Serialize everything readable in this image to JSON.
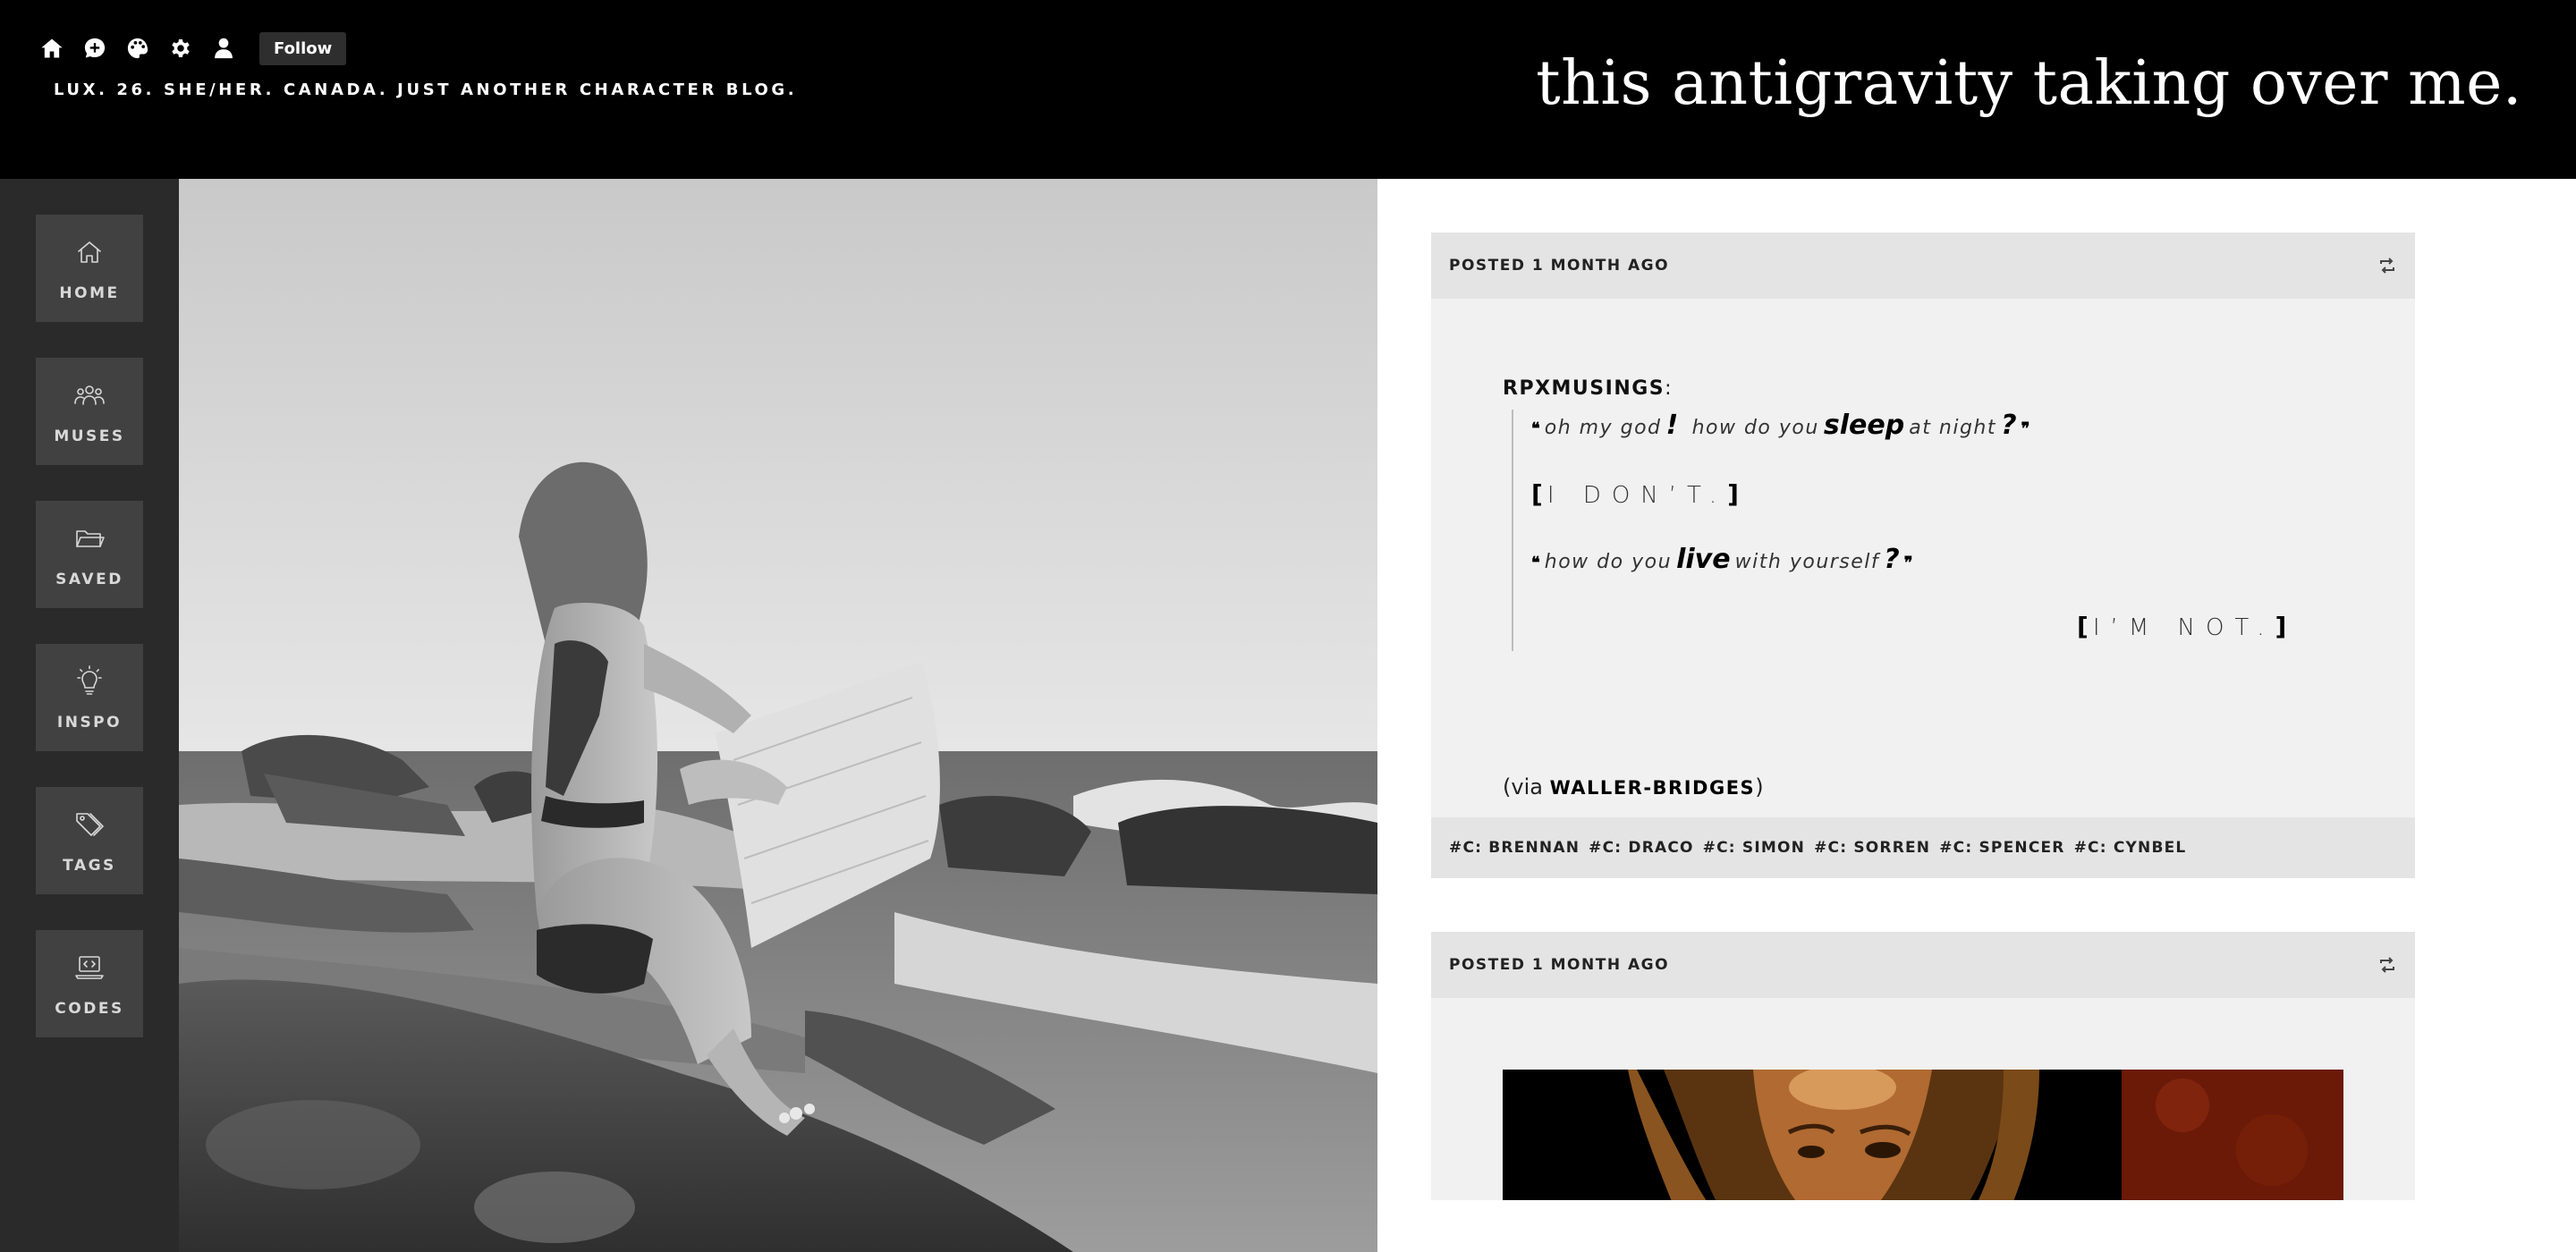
{
  "header": {
    "follow_label": "Follow",
    "description": "LUX. 26. SHE/HER. CANADA. JUST ANOTHER CHARACTER BLOG.",
    "title": "this antigravity taking over me.",
    "icons": [
      "home-icon",
      "chat-icon",
      "palette-icon",
      "gear-icon",
      "user-icon"
    ]
  },
  "sidebar": {
    "items": [
      {
        "label": "HOME",
        "icon": "home-icon"
      },
      {
        "label": "MUSES",
        "icon": "group-icon"
      },
      {
        "label": "SAVED",
        "icon": "folder-icon"
      },
      {
        "label": "INSPO",
        "icon": "lightbulb-icon"
      },
      {
        "label": "TAGS",
        "icon": "tag-icon"
      },
      {
        "label": "CODES",
        "icon": "code-laptop-icon"
      }
    ]
  },
  "posts": [
    {
      "time": "POSTED 1 MONTH AGO",
      "reblog_from": "RPXMUSINGS",
      "reblog_colon": ":",
      "quote": {
        "line1": {
          "open": "❝",
          "a": "oh my god",
          "b": "!",
          "c": "how do you",
          "d": "sleep",
          "e": "at night",
          "f": "?",
          "close": "❞"
        },
        "line2": {
          "open": "[",
          "text": "I DON’T.",
          "close": "]"
        },
        "line3": {
          "open": "❝",
          "a": "how do you",
          "b": "live",
          "c": "with yourself",
          "d": "?",
          "close": "❞"
        },
        "line4": {
          "open": "[",
          "text": "I’M NOT.",
          "close": "]"
        }
      },
      "via_prefix": "(via ",
      "via_name": "WALLER-BRIDGES",
      "via_suffix": ")",
      "tags": [
        "#C: BRENNAN",
        "#C: DRACO",
        "#C: SIMON",
        "#C: SORREN",
        "#C: SPENCER",
        "#C: CYNBEL"
      ]
    },
    {
      "time": "POSTED 1 MONTH AGO"
    }
  ],
  "colors": {
    "header_bg": "#000000",
    "sidebar_bg": "#2a2a2a",
    "nav_tile": "#414141",
    "post_bg": "#f1f1f1",
    "post_bar": "#e4e4e4"
  }
}
